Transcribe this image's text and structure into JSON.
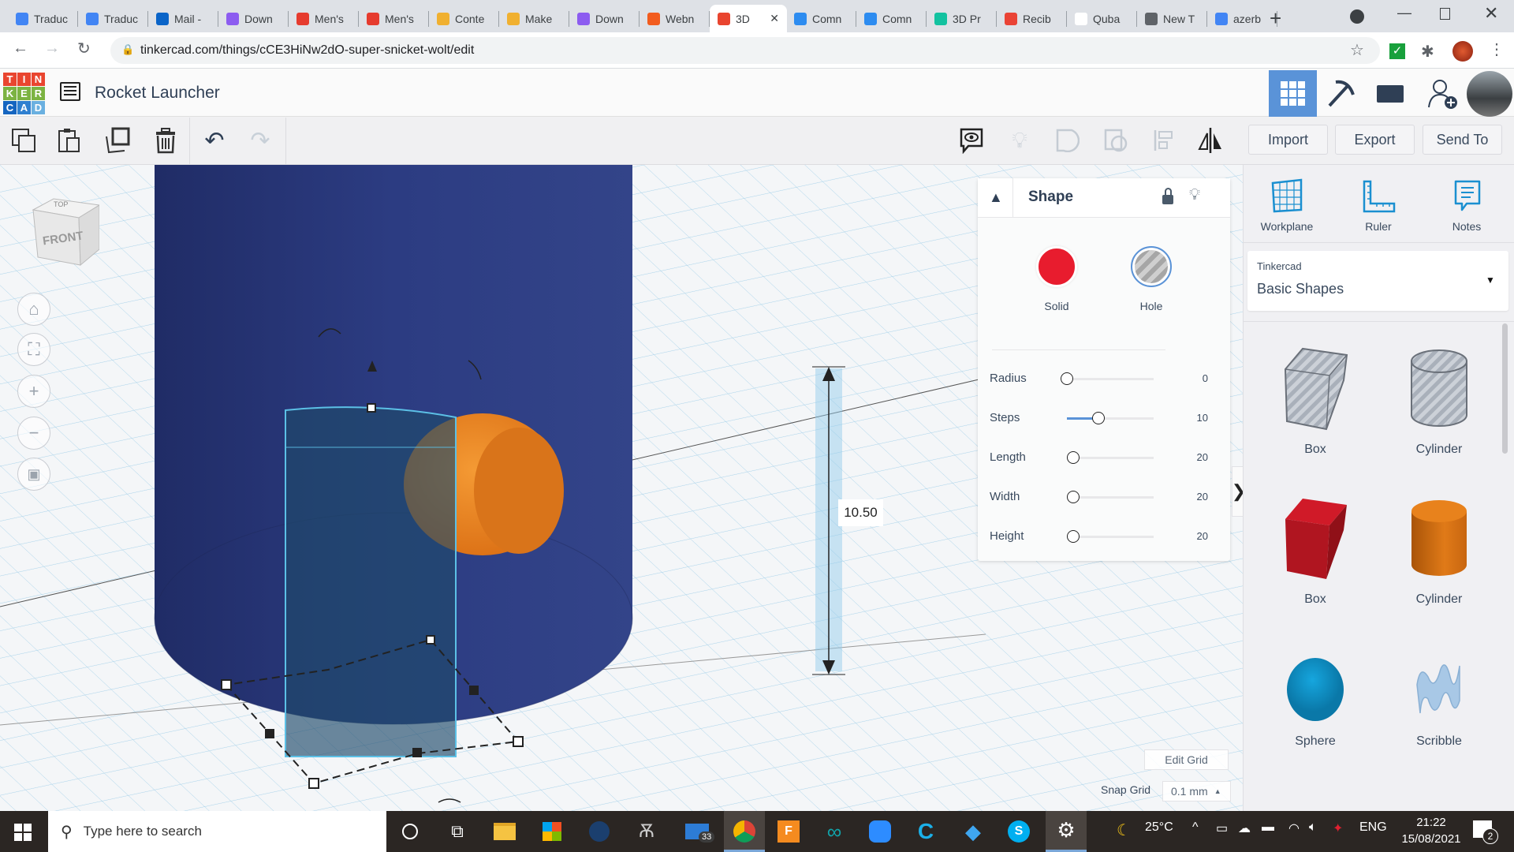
{
  "browser": {
    "tabs": [
      {
        "label": "Traduc",
        "icon": "google-translate-icon",
        "color": "#4285f4"
      },
      {
        "label": "Traduc",
        "icon": "google-translate-icon",
        "color": "#4285f4"
      },
      {
        "label": "Mail -",
        "icon": "outlook-icon",
        "color": "#0a64c8"
      },
      {
        "label": "Down",
        "icon": "download-app-icon",
        "color": "#8c5cf0"
      },
      {
        "label": "Men's",
        "icon": "shopping-bag-icon",
        "color": "#e63b2e"
      },
      {
        "label": "Men's",
        "icon": "shopping-bag-icon",
        "color": "#e63b2e"
      },
      {
        "label": "Conte",
        "icon": "mascot-icon",
        "color": "#f0b030"
      },
      {
        "label": "Make",
        "icon": "mascot-icon",
        "color": "#f0b030"
      },
      {
        "label": "Down",
        "icon": "download-app-icon",
        "color": "#8c5cf0"
      },
      {
        "label": "Webn",
        "icon": "webnode-icon",
        "color": "#f25c1e"
      },
      {
        "label": "3D",
        "icon": "tinkercad-icon",
        "color": "#e9452f"
      },
      {
        "label": "Comn",
        "icon": "t-app-icon",
        "color": "#2d8cf0"
      },
      {
        "label": "Comn",
        "icon": "t-app-icon",
        "color": "#2d8cf0"
      },
      {
        "label": "3D Pr",
        "icon": "3d-print-icon",
        "color": "#13c2a0"
      },
      {
        "label": "Recib",
        "icon": "gmail-icon",
        "color": "#ea4335"
      },
      {
        "label": "Quba",
        "icon": "wikipedia-icon",
        "color": "#ffffff"
      },
      {
        "label": "New T",
        "icon": "chrome-icon",
        "color": "#5f6368"
      },
      {
        "label": "azerb",
        "icon": "google-icon",
        "color": "#4285f4"
      }
    ],
    "url": "tinkercad.com/things/cCE3HiNw2dO-super-snicket-wolt/edit"
  },
  "app": {
    "logo": [
      "T",
      "I",
      "N",
      "K",
      "E",
      "R",
      "C",
      "A",
      "D"
    ],
    "title": "Rocket Launcher"
  },
  "toolbar": {
    "import": "Import",
    "export": "Export",
    "send_to": "Send To"
  },
  "inspector": {
    "title": "Shape",
    "solid": "Solid",
    "hole": "Hole",
    "solid_color": "#e81c2e",
    "params": [
      {
        "label": "Radius",
        "value": "0",
        "fraction": 0
      },
      {
        "label": "Steps",
        "value": "10",
        "fraction": 0.36
      },
      {
        "label": "Length",
        "value": "20",
        "fraction": 0.07
      },
      {
        "label": "Width",
        "value": "20",
        "fraction": 0.07
      },
      {
        "label": "Height",
        "value": "20",
        "fraction": 0.07
      }
    ]
  },
  "viewport": {
    "viewcube_top": "TOP",
    "viewcube_front": "FRONT",
    "dimension": "10.50",
    "edit_grid": "Edit Grid",
    "snap_grid_label": "Snap Grid",
    "snap_grid_value": "0.1 mm"
  },
  "panel": {
    "tools": [
      "Workplane",
      "Ruler",
      "Notes"
    ],
    "library_source": "Tinkercad",
    "library": "Basic Shapes",
    "shapes": [
      "Box",
      "Cylinder",
      "Box",
      "Cylinder",
      "Sphere",
      "Scribble"
    ]
  },
  "taskbar": {
    "search_placeholder": "Type here to search",
    "mail_badge": "33",
    "temperature": "25°C",
    "language": "ENG",
    "time": "21:22",
    "date": "15/08/2021",
    "notifications": "2"
  }
}
